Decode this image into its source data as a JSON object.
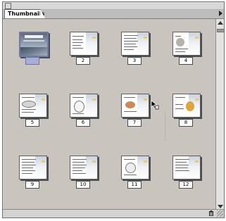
{
  "panel": {
    "tab_label": "Thumbnails",
    "menu_icon": "panel-menu-arrow-icon"
  },
  "thumbnails": [
    {
      "label": "",
      "selected": true,
      "kind": "cover"
    },
    {
      "label": "2",
      "selected": false,
      "kind": "text"
    },
    {
      "label": "3",
      "selected": false,
      "kind": "text"
    },
    {
      "label": "4",
      "selected": false,
      "kind": "text"
    },
    {
      "label": "5",
      "selected": false,
      "kind": "text"
    },
    {
      "label": "6",
      "selected": false,
      "kind": "figure"
    },
    {
      "label": "7",
      "selected": false,
      "kind": "figure"
    },
    {
      "label": "8",
      "selected": false,
      "kind": "figure"
    },
    {
      "label": "9",
      "selected": false,
      "kind": "text"
    },
    {
      "label": "10",
      "selected": false,
      "kind": "text"
    },
    {
      "label": "11",
      "selected": false,
      "kind": "figure"
    },
    {
      "label": "12",
      "selected": false,
      "kind": "text"
    }
  ],
  "icons": {
    "trash": "trash-icon",
    "resize": "resize-grip-icon",
    "cursor": "cursor-pointer-icon"
  },
  "colors": {
    "content_bg": "#cac4bf",
    "selection": "#a9aed6",
    "accent_rail": "#e7c78b"
  }
}
